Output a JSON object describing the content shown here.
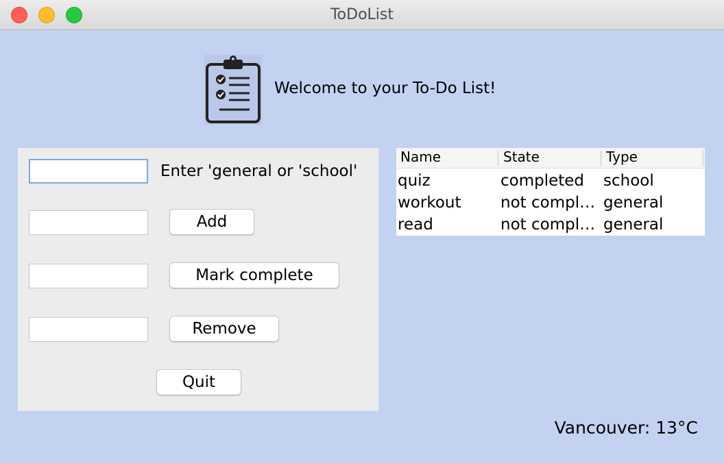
{
  "window": {
    "title": "ToDoList"
  },
  "header": {
    "logo_icon": "clipboard-checklist-icon",
    "welcome_text": "Welcome to your To-Do List!"
  },
  "form": {
    "type_input": {
      "value": "",
      "placeholder": ""
    },
    "type_hint": "Enter 'general or 'school'",
    "add_input": {
      "value": ""
    },
    "add_label": "Add",
    "complete_input": {
      "value": ""
    },
    "complete_label": "Mark complete",
    "remove_input": {
      "value": ""
    },
    "remove_label": "Remove",
    "quit_label": "Quit"
  },
  "table": {
    "columns": [
      "Name",
      "State",
      "Type"
    ],
    "rows": [
      [
        "quiz",
        "completed",
        "school"
      ],
      [
        "workout",
        "not completed",
        "general"
      ],
      [
        "read",
        "not completed",
        "general"
      ]
    ]
  },
  "weather": {
    "text": "Vancouver: 13°C"
  },
  "colors": {
    "background": "#c3d2f1",
    "panel": "#ececec",
    "focus": "#7ba7e6"
  }
}
